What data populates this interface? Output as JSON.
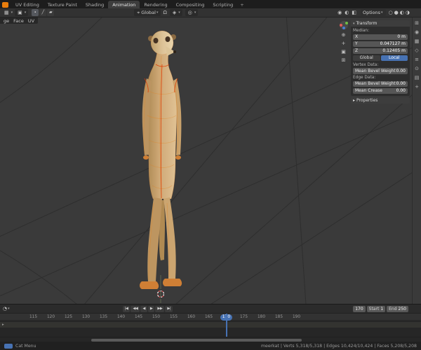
{
  "topbar": {
    "tabs": [
      "UV Editing",
      "Texture Paint",
      "Shading",
      "Animation",
      "Rendering",
      "Compositing",
      "Scripting"
    ],
    "add_tab": "+"
  },
  "header": {
    "orientation": "Global",
    "options": "Options"
  },
  "viewport": {
    "menus": [
      "ge",
      "Face",
      "UV"
    ]
  },
  "npanel": {
    "transform_title": "Transform",
    "median_label": "Median:",
    "median": [
      {
        "axis": "X",
        "value": "0 m"
      },
      {
        "axis": "Y",
        "value": "0.047127 m"
      },
      {
        "axis": "Z",
        "value": "0.12405 m"
      }
    ],
    "space_global": "Global",
    "space_local": "Local",
    "vertex_data_label": "Vertex Data:",
    "vertex_bevel_label": "Mean Bevel Weight",
    "vertex_bevel_value": "0.00",
    "edge_data_label": "Edge Data:",
    "edge_bevel_label": "Mean Bevel Weight",
    "edge_bevel_value": "0.00",
    "edge_crease_label": "Mean Crease",
    "edge_crease_value": "0.00",
    "properties_title": "Properties"
  },
  "timeline": {
    "playback": [
      "|◀",
      "◀◀",
      "◀",
      "▶",
      "▶▶",
      "▶|"
    ],
    "ticks_before": [
      "115",
      "120",
      "125",
      "130",
      "135",
      "140",
      "145",
      "150",
      "155",
      "160",
      "165"
    ],
    "current_frame": "170",
    "ticks_after": [
      "175",
      "180",
      "185",
      "190"
    ],
    "frame_field": "170",
    "start_label": "Start",
    "start_value": "1",
    "end_label": "End",
    "end_value": "250"
  },
  "statusbar": {
    "left": "Cat Menu",
    "right": "meerkat | Verts 5,318/5,318 | Edges 10,424/10,424 | Faces 5,208/5,208"
  },
  "icons": {
    "editor_type": "▦",
    "dropdown": "▾",
    "mode_cube": "▣",
    "vertex_select": "∙",
    "edge_select": "╱",
    "face_select": "▰",
    "orientation": "⌖",
    "magnet": "Ω",
    "snap": "◈",
    "proportional": "◎",
    "gizmo": "◉",
    "overlay": "◐",
    "xray": "◧",
    "shading": [
      "○",
      "●",
      "◐",
      "◑"
    ],
    "nav": [
      "⊕",
      "+",
      "▣",
      "⊞"
    ],
    "rail": [
      "⊞",
      "◉",
      "▦",
      "◇",
      "≡",
      "⊙",
      "▤",
      "+"
    ],
    "clock": "◔",
    "channel_arrow": "▸"
  },
  "colors": {
    "accent": "#4772b3",
    "selection": "#e8822e",
    "seam": "#d93b00"
  }
}
